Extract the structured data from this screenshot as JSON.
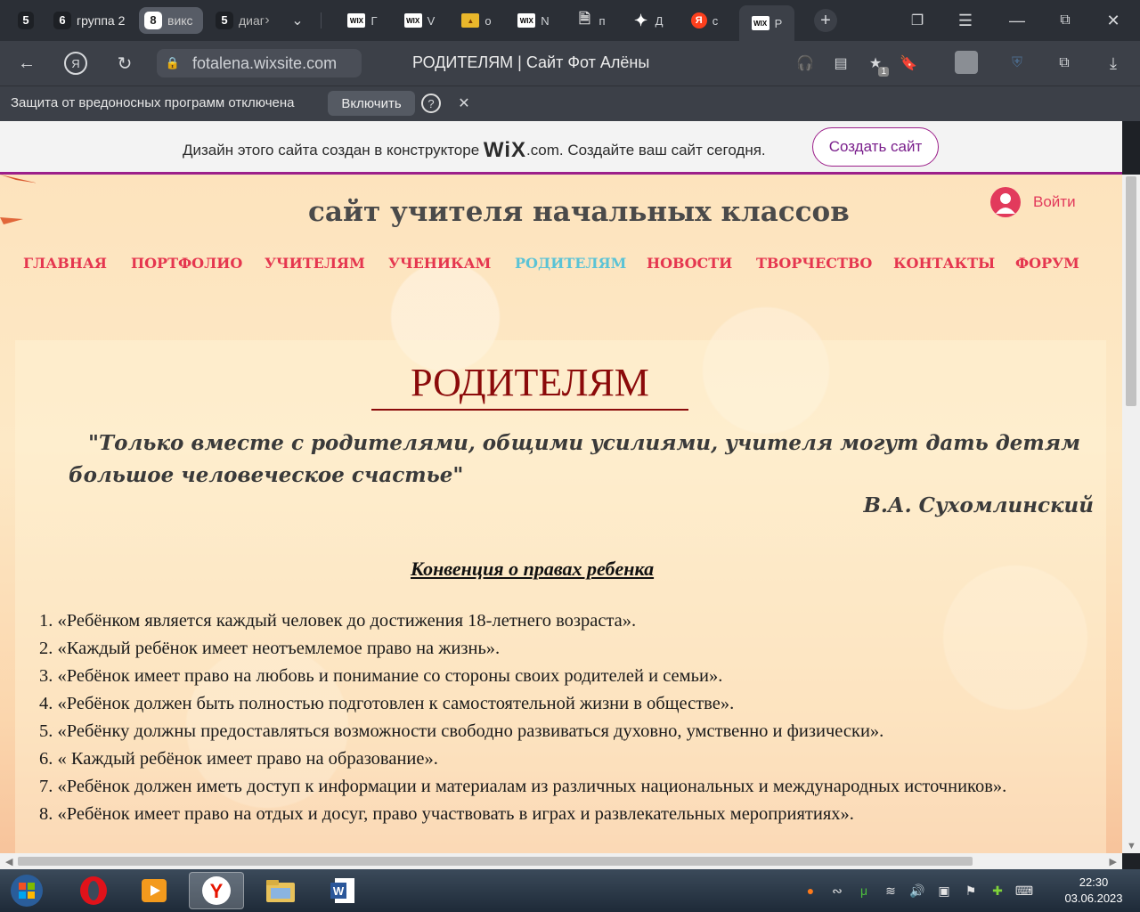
{
  "browser": {
    "tab_groups": [
      {
        "count": "5",
        "label": ""
      },
      {
        "count": "6",
        "label": "группа 2"
      },
      {
        "count": "8",
        "label": "викс"
      },
      {
        "count": "5",
        "label": "диаг"
      }
    ],
    "tabs": [
      {
        "favicon": "wix-favicon",
        "label": "Г"
      },
      {
        "favicon": "wix-favicon",
        "label": "V"
      },
      {
        "favicon": "image-favicon",
        "label": "о"
      },
      {
        "favicon": "wix-favicon",
        "label": "N"
      },
      {
        "favicon": "document-favicon",
        "label": "п"
      },
      {
        "favicon": "star-favicon",
        "label": "Д"
      },
      {
        "favicon": "yandex-favicon",
        "label": "с"
      },
      {
        "favicon": "wix-favicon",
        "label": "Р"
      }
    ],
    "url": "fotalena.wixsite.com",
    "page_title": "РОДИТЕЛЯМ | Сайт Фот Алёны",
    "notification_badge": "1",
    "protection_message": "Защита от вредоносных программ отключена",
    "protection_button": "Включить"
  },
  "wix_banner": {
    "text_before": "Дизайн этого сайта создан в конструкторе ",
    "logo": "WiX",
    "logo_suffix": ".com",
    "text_after": ". Создайте ваш сайт сегодня.",
    "button": "Создать сайт"
  },
  "site": {
    "title": "сайт учителя начальных классов",
    "login": "Войти",
    "nav": [
      {
        "label": "ГЛАВНАЯ",
        "active": false
      },
      {
        "label": "ПОРТФОЛИО",
        "active": false
      },
      {
        "label": "УЧИТЕЛЯМ",
        "active": false
      },
      {
        "label": "УЧЕНИКАМ",
        "active": false
      },
      {
        "label": "РОДИТЕЛЯМ",
        "active": true
      },
      {
        "label": "НОВОСТИ",
        "active": false
      },
      {
        "label": "ТВОРЧЕСТВО",
        "active": false
      },
      {
        "label": "КОНТАКТЫ",
        "active": false
      },
      {
        "label": "ФОРУМ",
        "active": false
      }
    ],
    "heading": "РОДИТЕЛЯМ",
    "quote": "\"Только вместе с родителями, общими усилиями, учителя могут дать детям большое человеческое счастье\"",
    "quote_author": "В.А. Сухомлинский",
    "convention_title": "Конвенция о правах ребенка",
    "items": [
      "1. «Ребёнком является каждый человек до достижения 18-летнего возраста».",
      "2. «Каждый ребёнок имеет неотъемлемое право на жизнь».",
      "3. «Ребёнок имеет право на любовь и понимание со стороны своих родителей и семьи».",
      "4. «Ребёнок должен быть полностью подготовлен к самостоятельной жизни в обществе».",
      "5. «Ребёнку должны предоставляться возможности свободно развиваться духовно, умственно и физически».",
      "6. « Каждый ребёнок имеет право на образование».",
      "7. «Ребёнок должен иметь доступ к информации и материалам из различных национальных и международных источников».",
      "8. «Ребёнок имеет право на отдых и досуг, право участвовать в играх и развлекательных мероприятиях»."
    ]
  },
  "taskbar": {
    "apps": [
      "windows-start-icon",
      "opera-icon",
      "video-player-icon",
      "yandex-browser-icon",
      "file-explorer-icon",
      "word-icon"
    ],
    "time": "22:30",
    "date": "03.06.2023"
  },
  "colors": {
    "nav": "#e5364f",
    "nav_active": "#5ac3d6",
    "heading": "#8b0a0a",
    "wix_accent": "#9c1f8a"
  }
}
